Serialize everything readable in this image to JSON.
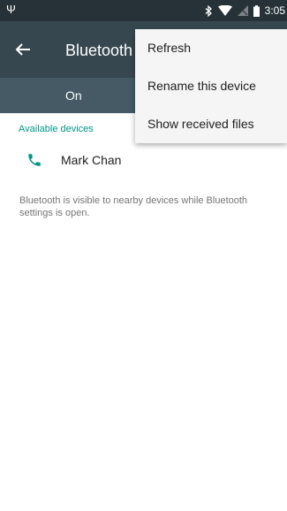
{
  "status_bar": {
    "time": "3:05",
    "icons": [
      "usb-icon",
      "bluetooth-icon",
      "wifi-icon",
      "no-signal-icon",
      "battery-icon"
    ]
  },
  "app_bar": {
    "title": "Bluetooth",
    "back_icon": "arrow-back-icon"
  },
  "toggle": {
    "label": "On"
  },
  "devices": {
    "header": "Available devices",
    "items": [
      {
        "name": "Mark Chan",
        "icon": "phone-icon"
      }
    ]
  },
  "footer": {
    "text": "Bluetooth is visible to nearby devices while Bluetooth settings is open."
  },
  "menu": {
    "items": [
      "Refresh",
      "Rename this device",
      "Show received files"
    ]
  },
  "colors": {
    "status_bar": "#263238",
    "app_bar": "#37474f",
    "toggle_bar": "#455a64",
    "accent": "#009688",
    "menu_bg": "#f5f5f5"
  }
}
